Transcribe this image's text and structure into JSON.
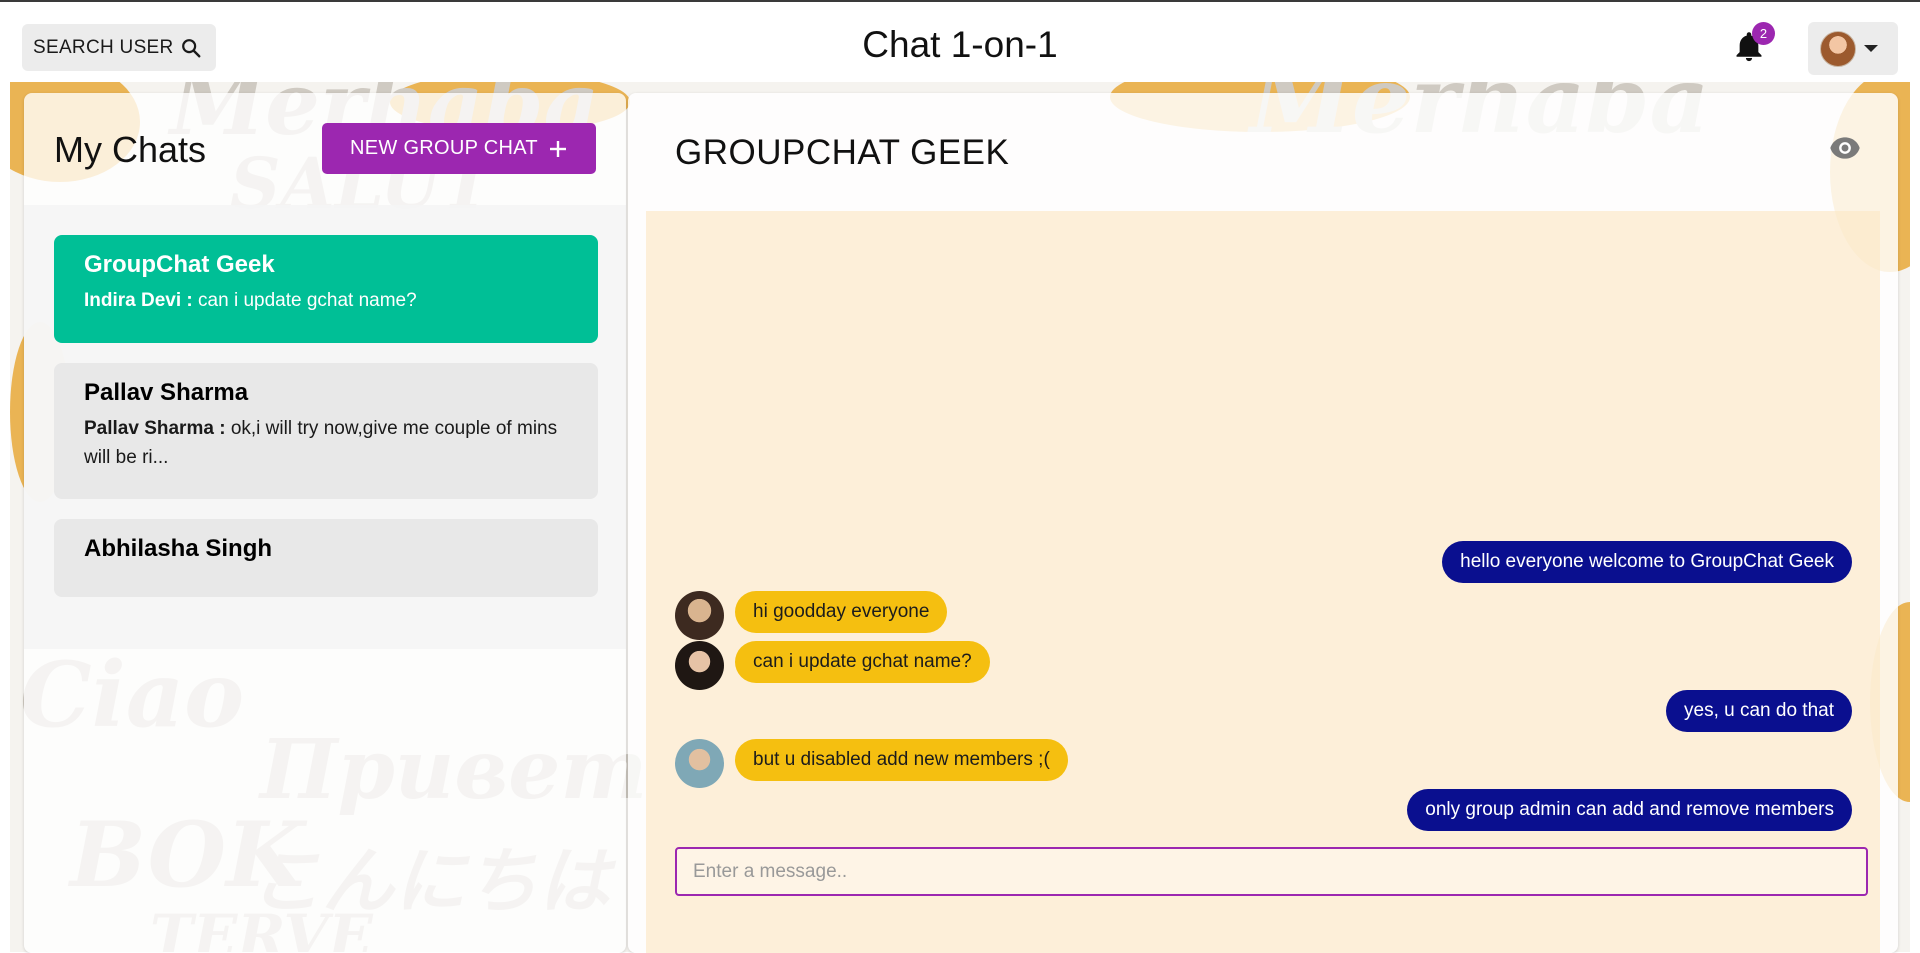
{
  "header": {
    "search_label": "SEARCH USER",
    "title": "Chat 1-on-1",
    "notification_count": "2"
  },
  "sidebar": {
    "title": "My Chats",
    "new_group_label": "NEW GROUP CHAT",
    "chats": [
      {
        "name": "GroupChat Geek",
        "sender": "Indira Devi :",
        "message": "can i update gchat name?",
        "active": true
      },
      {
        "name": "Pallav Sharma",
        "sender": "Pallav Sharma :",
        "message": "ok,i will try now,give me couple of mins will be ri...",
        "active": false
      },
      {
        "name": "Abhilasha Singh",
        "sender": "",
        "message": "",
        "active": false
      }
    ]
  },
  "chat": {
    "title": "GROUPCHAT GEEK",
    "messages": [
      {
        "text": "hello everyone welcome to GroupChat Geek",
        "direction": "out"
      },
      {
        "text": "hi goodday everyone",
        "direction": "in"
      },
      {
        "text": "can i update gchat name?",
        "direction": "in"
      },
      {
        "text": "yes, u can do that",
        "direction": "out"
      },
      {
        "text": "but u disabled add new members ;(",
        "direction": "in"
      },
      {
        "text": "only group admin can add and remove members",
        "direction": "out"
      }
    ],
    "input_placeholder": "Enter a message.."
  },
  "colors": {
    "accent": "#9c27b0",
    "active_chat": "#00bf96",
    "outgoing_bubble": "#0a0f8f",
    "incoming_bubble": "#f5bf10"
  },
  "icons": [
    "search-icon",
    "bell-icon",
    "chevron-down-icon",
    "plus-icon",
    "eye-icon"
  ]
}
